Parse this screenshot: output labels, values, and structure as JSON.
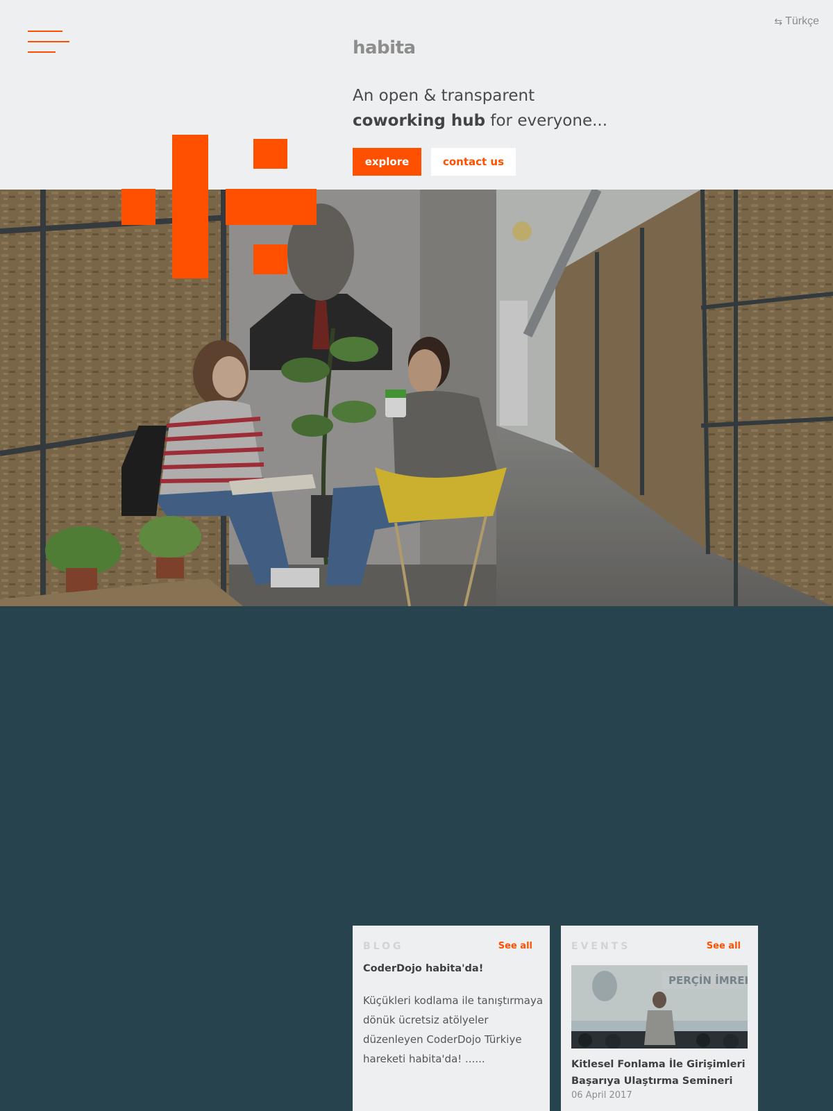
{
  "language_switch": {
    "label": "Türkçe",
    "icon": "swap-arrows-icon"
  },
  "brand": {
    "logo_text": "habita",
    "accent_color": "#ff5000",
    "dark_color": "#27444e"
  },
  "hero": {
    "tagline_line1": "An open & transparent",
    "tagline_bold": "coworking hub",
    "tagline_rest": " for everyone..."
  },
  "actions": {
    "explore": "explore",
    "contact": "contact us"
  },
  "blog": {
    "label": "BLOG",
    "see_all": "See all",
    "post_title": "CoderDojo habita'da!",
    "post_excerpt": "Küçükleri kodlama ile tanıştırmaya dönük ücretsiz atölyeler düzenleyen CoderDojo Türkiye hareketi habita'da! ......"
  },
  "events": {
    "label": "EVENTS",
    "see_all": "See all",
    "banner_text": "PERÇİN İMREK",
    "event_title": "Kitlesel Fonlama İle Girişimleri Başarıya Ulaştırma Semineri",
    "event_date": "06 April 2017"
  }
}
